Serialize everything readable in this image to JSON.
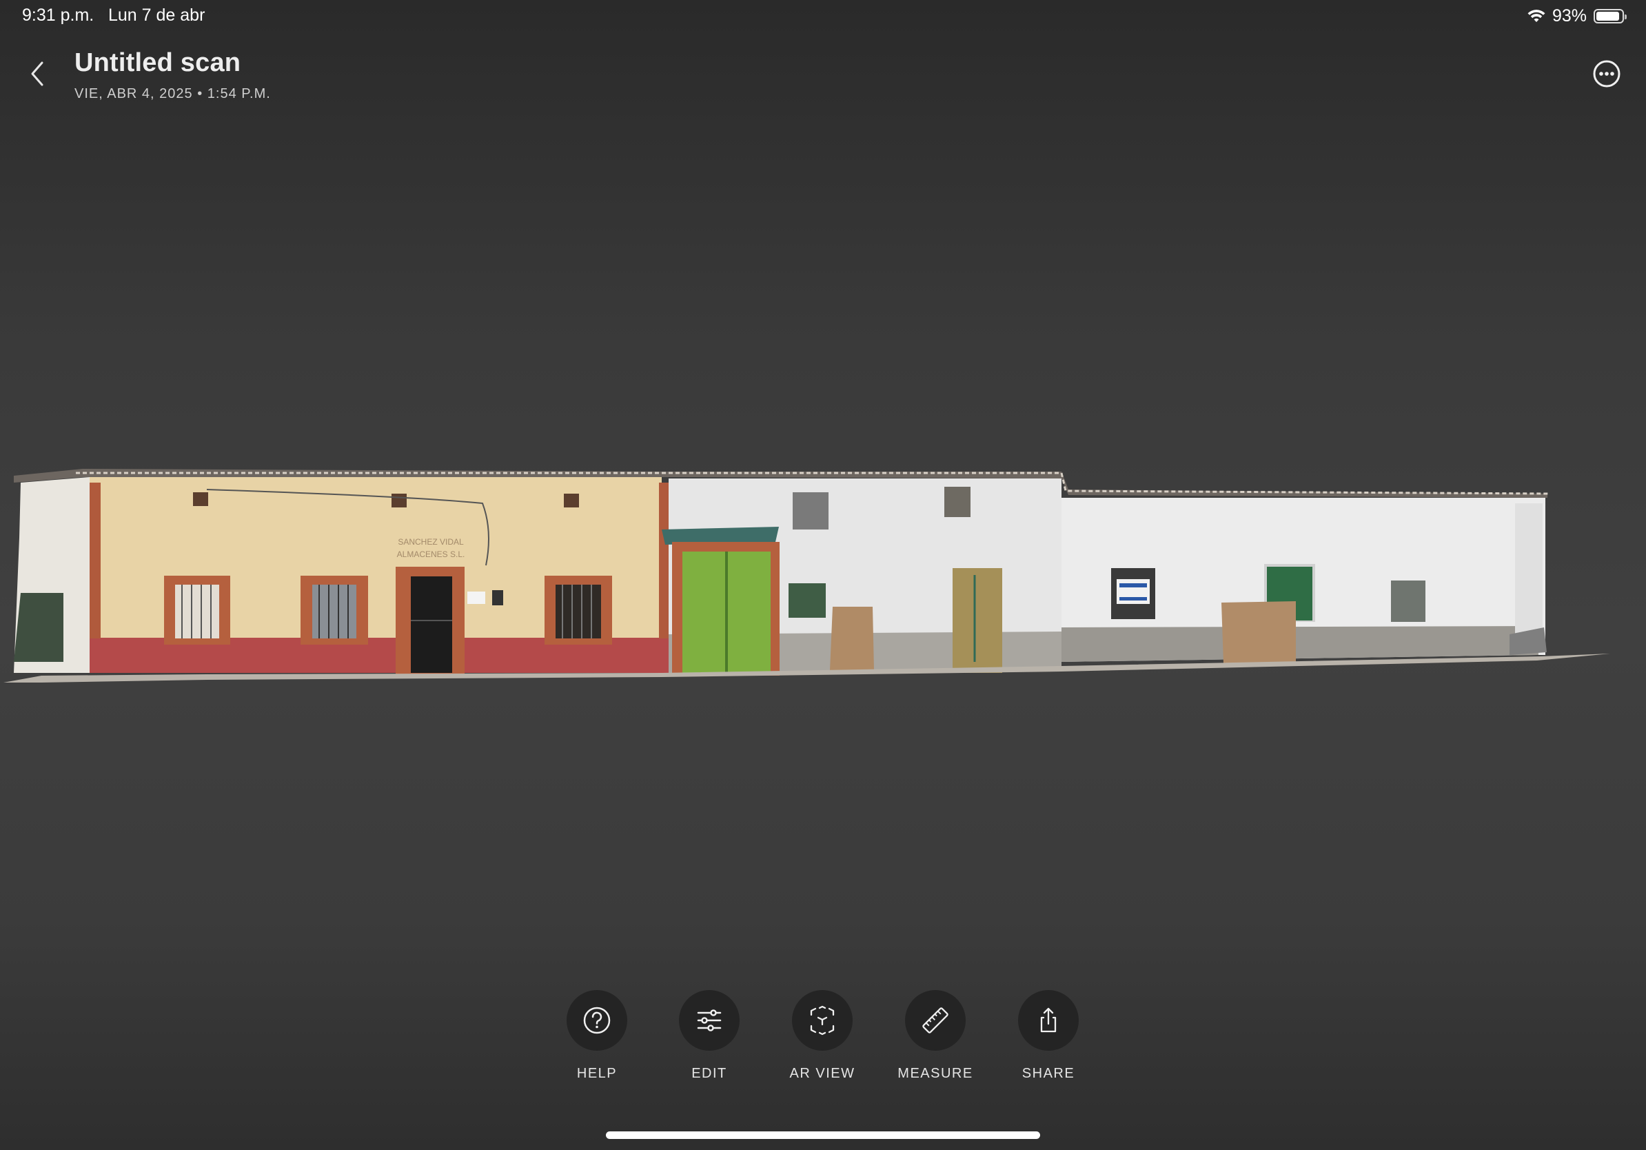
{
  "status": {
    "time": "9:31 p.m.",
    "date": "Lun 7 de abr",
    "battery_percent": "93%",
    "battery_level": 0.93,
    "icons": [
      "wifi-icon",
      "battery-icon"
    ]
  },
  "header": {
    "back_icon": "chevron-left-icon",
    "title": "Untitled scan",
    "subtitle": "VIE, ABR 4, 2025  •  1:54 P.M.",
    "more_icon": "ellipsis-circle-icon"
  },
  "scan": {
    "sign_line1": "SANCHEZ VIDAL",
    "sign_line2": "ALMACENES S.L."
  },
  "toolbar": {
    "help_label": "HELP",
    "edit_label": "EDIT",
    "ar_view_label": "AR VIEW",
    "measure_label": "MEASURE",
    "share_label": "SHARE",
    "icons": [
      "question-circle-icon",
      "sliders-icon",
      "ar-cube-icon",
      "ruler-icon",
      "share-icon"
    ]
  },
  "colors": {
    "background": "#3d3d3d",
    "button_bg": "#242424",
    "text": "#ffffff"
  }
}
